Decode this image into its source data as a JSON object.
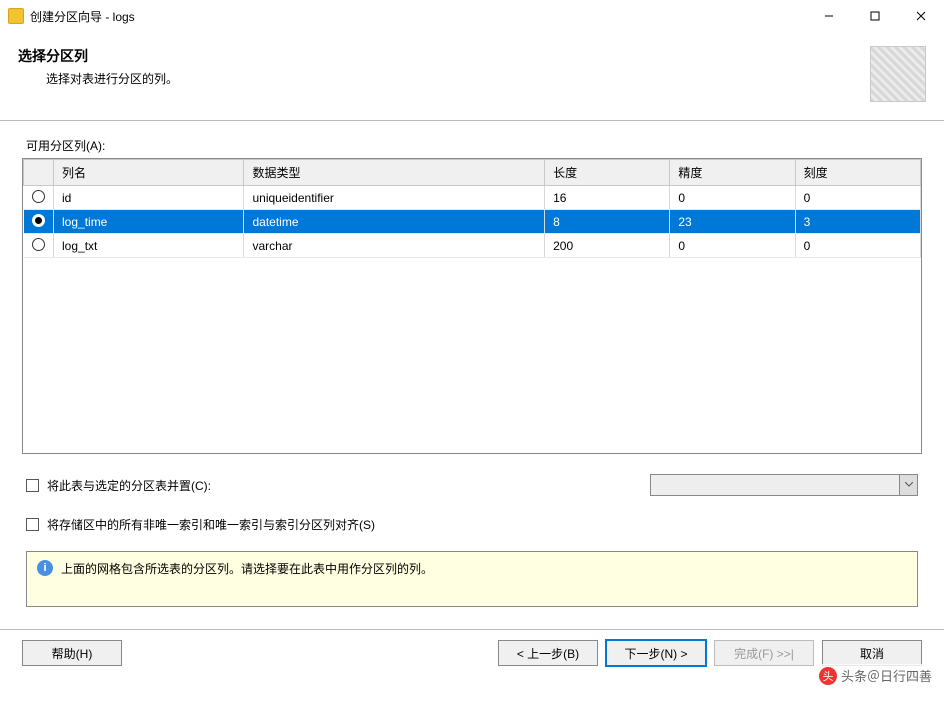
{
  "window": {
    "title": "创建分区向导 - logs"
  },
  "header": {
    "heading": "选择分区列",
    "subtitle": "选择对表进行分区的列。"
  },
  "section_label": "可用分区列(A):",
  "columns": {
    "select": "",
    "name": "列名",
    "datatype": "数据类型",
    "length": "长度",
    "precision": "精度",
    "scale": "刻度"
  },
  "rows": [
    {
      "selected": false,
      "name": "id",
      "datatype": "uniqueidentifier",
      "length": "16",
      "precision": "0",
      "scale": "0"
    },
    {
      "selected": true,
      "name": "log_time",
      "datatype": "datetime",
      "length": "8",
      "precision": "23",
      "scale": "3"
    },
    {
      "selected": false,
      "name": "log_txt",
      "datatype": "varchar",
      "length": "200",
      "precision": "0",
      "scale": "0"
    }
  ],
  "collocate_label": "将此表与选定的分区表并置(C):",
  "align_indexes_label": "将存储区中的所有非唯一索引和唯一索引与索引分区列对齐(S)",
  "info_text": "上面的网格包含所选表的分区列。请选择要在此表中用作分区列的列。",
  "buttons": {
    "help": "帮助(H)",
    "back": "< 上一步(B)",
    "next": "下一步(N) >",
    "finish": "完成(F) >>|",
    "cancel": "取消"
  },
  "watermark": "头条＠日行四善"
}
